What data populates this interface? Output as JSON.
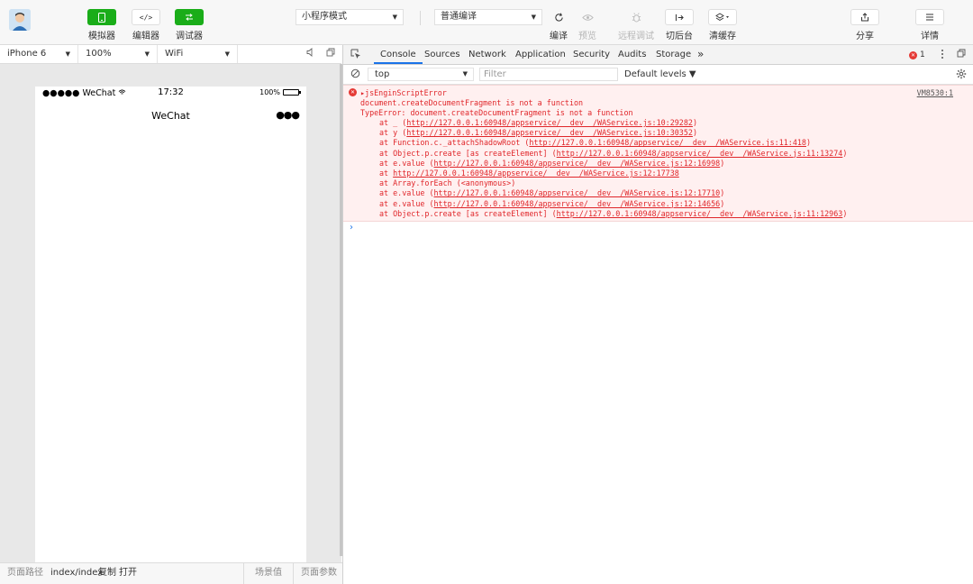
{
  "toolbar": {
    "simulator_label": "模拟器",
    "editor_label": "编辑器",
    "debugger_label": "调试器",
    "editor_glyph": "</>",
    "mode_select": "小程序模式",
    "compile_select": "普通编译",
    "compile_label": "编译",
    "preview_label": "预览",
    "remote_debug_label": "远程调试",
    "background_label": "切后台",
    "clear_cache_label": "清缓存",
    "share_label": "分享",
    "details_label": "详情"
  },
  "device_bar": {
    "device": "iPhone 6",
    "zoom": "100%",
    "network": "WiFi"
  },
  "phone": {
    "carrier": "●●●●● WeChat",
    "time": "17:32",
    "battery_text": "100%",
    "battery_level": 1.0,
    "nav_title": "WeChat",
    "more": "●●●"
  },
  "footer": {
    "path_label": "页面路径",
    "path_value": "index/index",
    "copy_label": "复制",
    "open_label": "打开",
    "scene_label": "场景值",
    "params_label": "页面参数"
  },
  "devtools": {
    "tabs": [
      "Console",
      "Sources",
      "Network",
      "Application",
      "Security",
      "Audits",
      "Storage"
    ],
    "more_tabs": "»",
    "error_count": "1",
    "context": "top",
    "filter_placeholder": "Filter",
    "levels": "Default levels ▼",
    "error": {
      "title": "▸jsEnginScriptError",
      "source": "VM8530:1",
      "message": "document.createDocumentFragment is not a function",
      "type_line": "TypeError: document.createDocumentFragment is not a function",
      "stack": [
        {
          "prefix": "at _ (",
          "link": "http://127.0.0.1:60948/appservice/__dev__/WAService.js:10:29282",
          "suffix": ")"
        },
        {
          "prefix": "at y (",
          "link": "http://127.0.0.1:60948/appservice/__dev__/WAService.js:10:30352",
          "suffix": ")"
        },
        {
          "prefix": "at Function.c._attachShadowRoot (",
          "link": "http://127.0.0.1:60948/appservice/__dev__/WAService.js:11:418",
          "suffix": ")"
        },
        {
          "prefix": "at Object.p.create [as createElement] (",
          "link": "http://127.0.0.1:60948/appservice/__dev__/WAService.js:11:13274",
          "suffix": ")"
        },
        {
          "prefix": "at e.value (",
          "link": "http://127.0.0.1:60948/appservice/__dev__/WAService.js:12:16998",
          "suffix": ")"
        },
        {
          "prefix": "at ",
          "link": "http://127.0.0.1:60948/appservice/__dev__/WAService.js:12:17738",
          "suffix": ""
        },
        {
          "prefix": "at Array.forEach (<anonymous>)",
          "link": "",
          "suffix": ""
        },
        {
          "prefix": "at e.value (",
          "link": "http://127.0.0.1:60948/appservice/__dev__/WAService.js:12:17710",
          "suffix": ")"
        },
        {
          "prefix": "at e.value (",
          "link": "http://127.0.0.1:60948/appservice/__dev__/WAService.js:12:14656",
          "suffix": ")"
        },
        {
          "prefix": "at Object.p.create [as createElement] (",
          "link": "http://127.0.0.1:60948/appservice/__dev__/WAService.js:11:12963",
          "suffix": ")"
        }
      ]
    },
    "prompt": "›"
  }
}
